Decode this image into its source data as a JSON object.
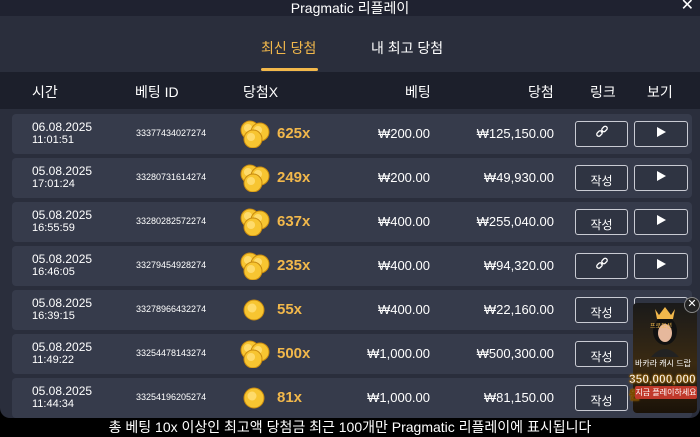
{
  "window": {
    "title": "Pragmatic 리플레이",
    "close_glyph": "✕"
  },
  "tabs": [
    {
      "label": "최신 당첨",
      "active": true
    },
    {
      "label": "내 최고 당첨",
      "active": false
    }
  ],
  "columns": {
    "time": "시간",
    "bet_id": "베팅 ID",
    "multiplier": "당첨X",
    "bet": "베팅",
    "win": "당첨",
    "link": "링크",
    "view": "보기"
  },
  "rows": [
    {
      "date": "06.08.2025",
      "time": "11:01:51",
      "bet_id": "33377434027274",
      "coins": "stack",
      "multiplier": "625x",
      "bet": "₩200.00",
      "win": "₩125,150.00",
      "link_type": "icon",
      "link_label": "",
      "link_icon": "chain-link-icon"
    },
    {
      "date": "05.08.2025",
      "time": "17:01:24",
      "bet_id": "33280731614274",
      "coins": "stack",
      "multiplier": "249x",
      "bet": "₩200.00",
      "win": "₩49,930.00",
      "link_type": "text",
      "link_label": "작성",
      "link_icon": ""
    },
    {
      "date": "05.08.2025",
      "time": "16:55:59",
      "bet_id": "33280282572274",
      "coins": "stack",
      "multiplier": "637x",
      "bet": "₩400.00",
      "win": "₩255,040.00",
      "link_type": "text",
      "link_label": "작성",
      "link_icon": ""
    },
    {
      "date": "05.08.2025",
      "time": "16:46:05",
      "bet_id": "33279454928274",
      "coins": "stack",
      "multiplier": "235x",
      "bet": "₩400.00",
      "win": "₩94,320.00",
      "link_type": "icon",
      "link_label": "",
      "link_icon": "chain-link-icon"
    },
    {
      "date": "05.08.2025",
      "time": "16:39:15",
      "bet_id": "33278966432274",
      "coins": "single",
      "multiplier": "55x",
      "bet": "₩400.00",
      "win": "₩22,160.00",
      "link_type": "text",
      "link_label": "작성",
      "link_icon": ""
    },
    {
      "date": "05.08.2025",
      "time": "11:49:22",
      "bet_id": "33254478143274",
      "coins": "stack",
      "multiplier": "500x",
      "bet": "₩1,000.00",
      "win": "₩500,300.00",
      "link_type": "text",
      "link_label": "작성",
      "link_icon": ""
    },
    {
      "date": "05.08.2025",
      "time": "11:44:34",
      "bet_id": "33254196205274",
      "coins": "single",
      "multiplier": "81x",
      "bet": "₩1,000.00",
      "win": "₩81,150.00",
      "link_type": "text",
      "link_label": "작성",
      "link_icon": ""
    }
  ],
  "footer": "총 베팅 10x 이상인 최고액 당첨금 최근 100개만 Pragmatic 리플레이에 표시됩니다",
  "promo": {
    "badge": "프로모션",
    "subtitle": "바카라 캐시 드랍",
    "amount": "350,000,000원",
    "cta": "지금 플레이하세요",
    "close_glyph": "✕"
  },
  "colors": {
    "accent": "#f2b84b",
    "panel": "#2a2e3c",
    "row": "#363b4b",
    "header": "#1c1f2b"
  }
}
